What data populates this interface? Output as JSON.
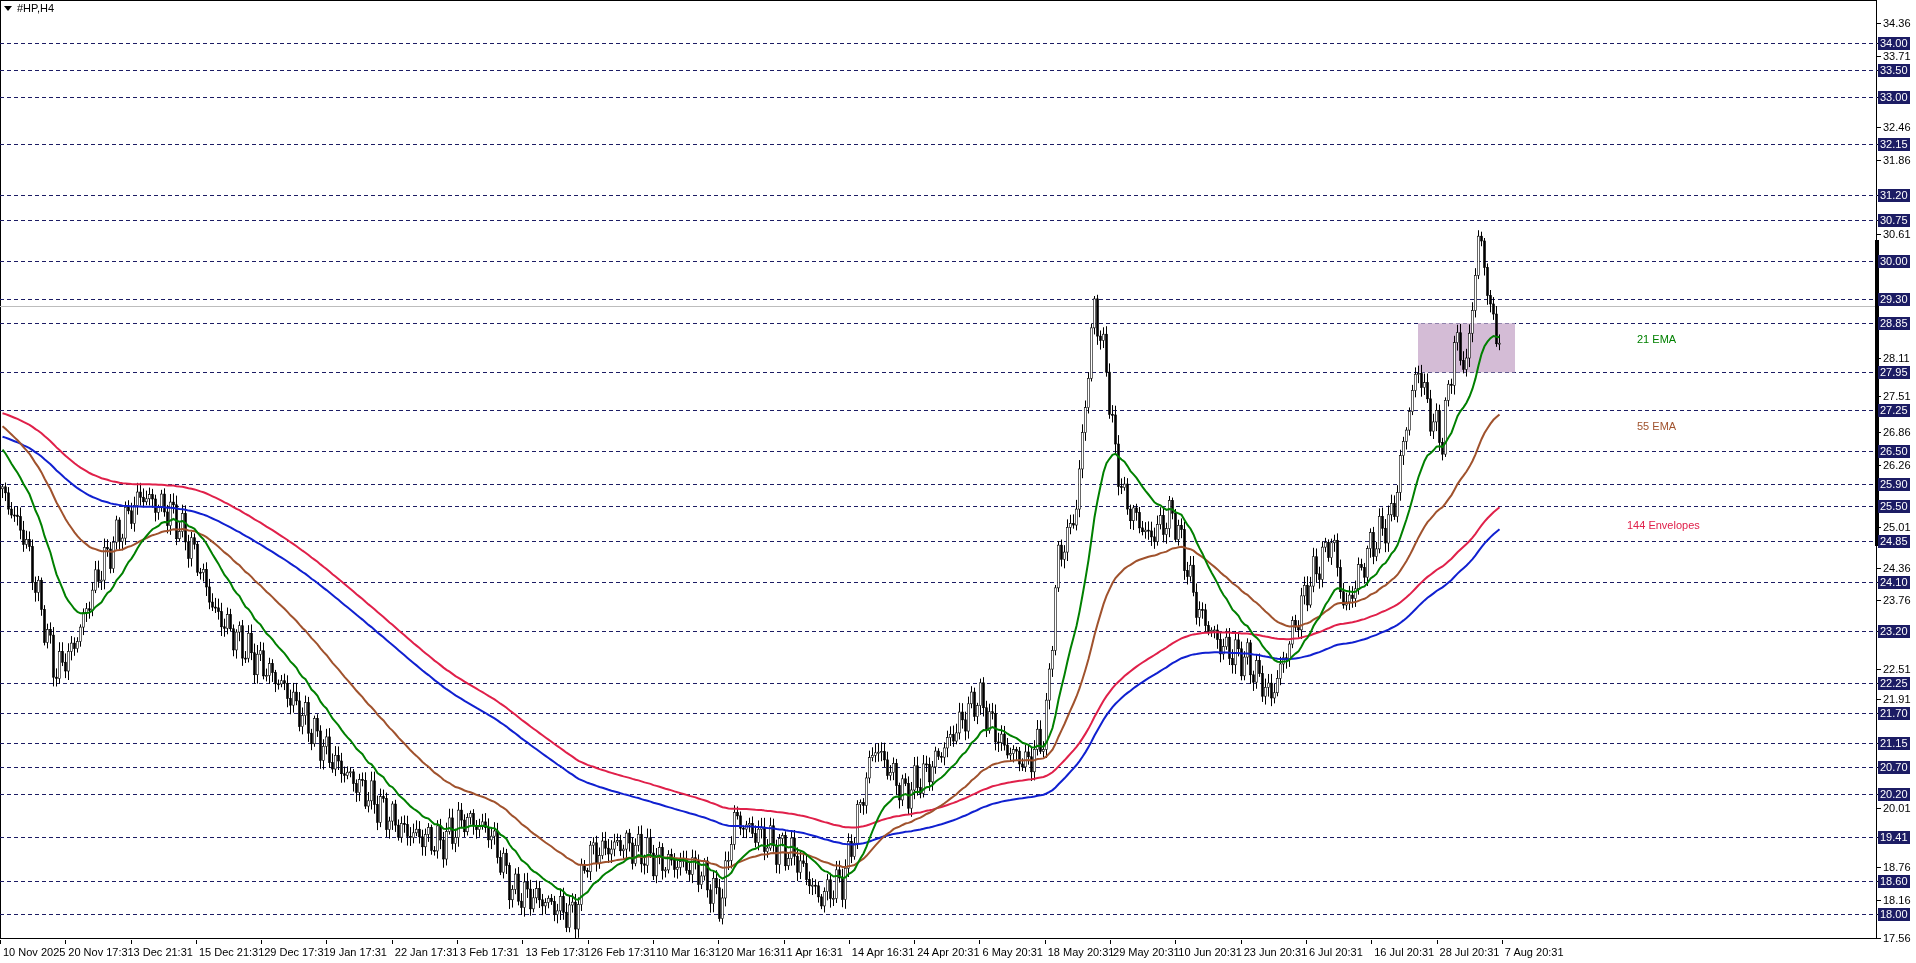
{
  "chart_title": "#HP,H4",
  "price_axis": [
    {
      "text": "34.36",
      "kind": "tick"
    },
    {
      "text": "34.00",
      "kind": "level"
    },
    {
      "text": "33.71",
      "kind": "tick"
    },
    {
      "text": "33.50",
      "kind": "level"
    },
    {
      "text": "33.00",
      "kind": "level"
    },
    {
      "text": "32.46",
      "kind": "tick"
    },
    {
      "text": "32.15",
      "kind": "level"
    },
    {
      "text": "31.86",
      "kind": "tick"
    },
    {
      "text": "31.20",
      "kind": "level"
    },
    {
      "text": "30.75",
      "kind": "level"
    },
    {
      "text": "30.61",
      "kind": "tick"
    },
    {
      "text": "30.00",
      "kind": "level"
    },
    {
      "text": "29.30",
      "kind": "level"
    },
    {
      "text": "28.85",
      "kind": "level"
    },
    {
      "text": "28.11",
      "kind": "tick"
    },
    {
      "text": "27.95",
      "kind": "level"
    },
    {
      "text": "27.51",
      "kind": "tick"
    },
    {
      "text": "27.25",
      "kind": "level"
    },
    {
      "text": "26.86",
      "kind": "tick"
    },
    {
      "text": "26.50",
      "kind": "level"
    },
    {
      "text": "26.26",
      "kind": "tick"
    },
    {
      "text": "25.90",
      "kind": "level"
    },
    {
      "text": "25.50",
      "kind": "level"
    },
    {
      "text": "25.01",
      "kind": "tick"
    },
    {
      "text": "24.85",
      "kind": "level"
    },
    {
      "text": "24.36",
      "kind": "tick"
    },
    {
      "text": "24.10",
      "kind": "level"
    },
    {
      "text": "23.76",
      "kind": "tick"
    },
    {
      "text": "23.20",
      "kind": "level"
    },
    {
      "text": "22.51",
      "kind": "tick"
    },
    {
      "text": "22.25",
      "kind": "level"
    },
    {
      "text": "21.91",
      "kind": "tick"
    },
    {
      "text": "21.70",
      "kind": "level"
    },
    {
      "text": "21.15",
      "kind": "level"
    },
    {
      "text": "20.70",
      "kind": "level"
    },
    {
      "text": "20.20",
      "kind": "level"
    },
    {
      "text": "20.01",
      "kind": "tick"
    },
    {
      "text": "19.41",
      "kind": "level"
    },
    {
      "text": "18.76",
      "kind": "tick"
    },
    {
      "text": "18.60",
      "kind": "level"
    },
    {
      "text": "18.16",
      "kind": "tick"
    },
    {
      "text": "18.00",
      "kind": "level"
    },
    {
      "text": "17.56",
      "kind": "tick"
    }
  ],
  "time_axis": [
    "10 Nov 2025",
    "20 Nov 17:31",
    "3 Dec 21:31",
    "15 Dec 21:31",
    "29 Dec 17:31",
    "9 Jan 17:31",
    "22 Jan 17:31",
    "3 Feb 17:31",
    "13 Feb 17:31",
    "26 Feb 17:31",
    "10 Mar 16:31",
    "20 Mar 16:31",
    "1 Apr 16:31",
    "14 Apr 16:31",
    "24 Apr 20:31",
    "6 May 20:31",
    "18 May 20:31",
    "29 May 20:31",
    "10 Jun 20:31",
    "23 Jun 20:31",
    "6 Jul 20:31",
    "16 Jul 20:31",
    "28 Jul 20:31",
    "7 Aug 20:31"
  ],
  "indicator_labels": [
    {
      "text": "21 EMA",
      "color": "#008000"
    },
    {
      "text": "55 EMA",
      "color": "#a0522d"
    },
    {
      "text": "144 Envelopes",
      "color": "#e0204a"
    }
  ]
}
